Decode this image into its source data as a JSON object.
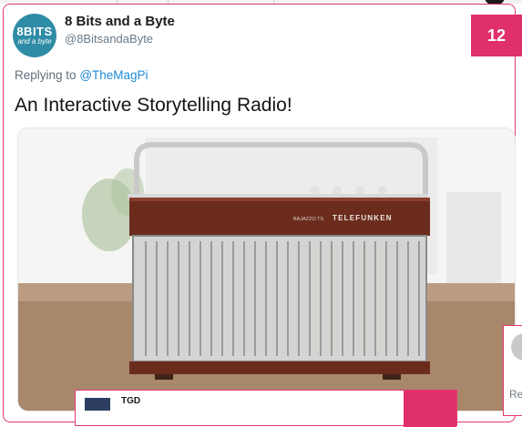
{
  "tweet": {
    "avatar_line1": "8BITS",
    "avatar_line2": "and a byte",
    "name": "8 Bits and a Byte",
    "handle": "@8BitsandaByte",
    "reply_prefix": "Replying to",
    "reply_mention": "@TheMagPi",
    "text": "An Interactive Storytelling Radio!",
    "badge_number": "12"
  },
  "radio": {
    "brand": "TELEFUNKEN",
    "model": "BAJAZZO TS"
  },
  "next_card": {
    "title": "TGD"
  },
  "side_card": {
    "text": "Re"
  },
  "colors": {
    "accent": "#e0306a",
    "link": "#1d8bd6",
    "avatar_bg": "#2f8ca6"
  }
}
